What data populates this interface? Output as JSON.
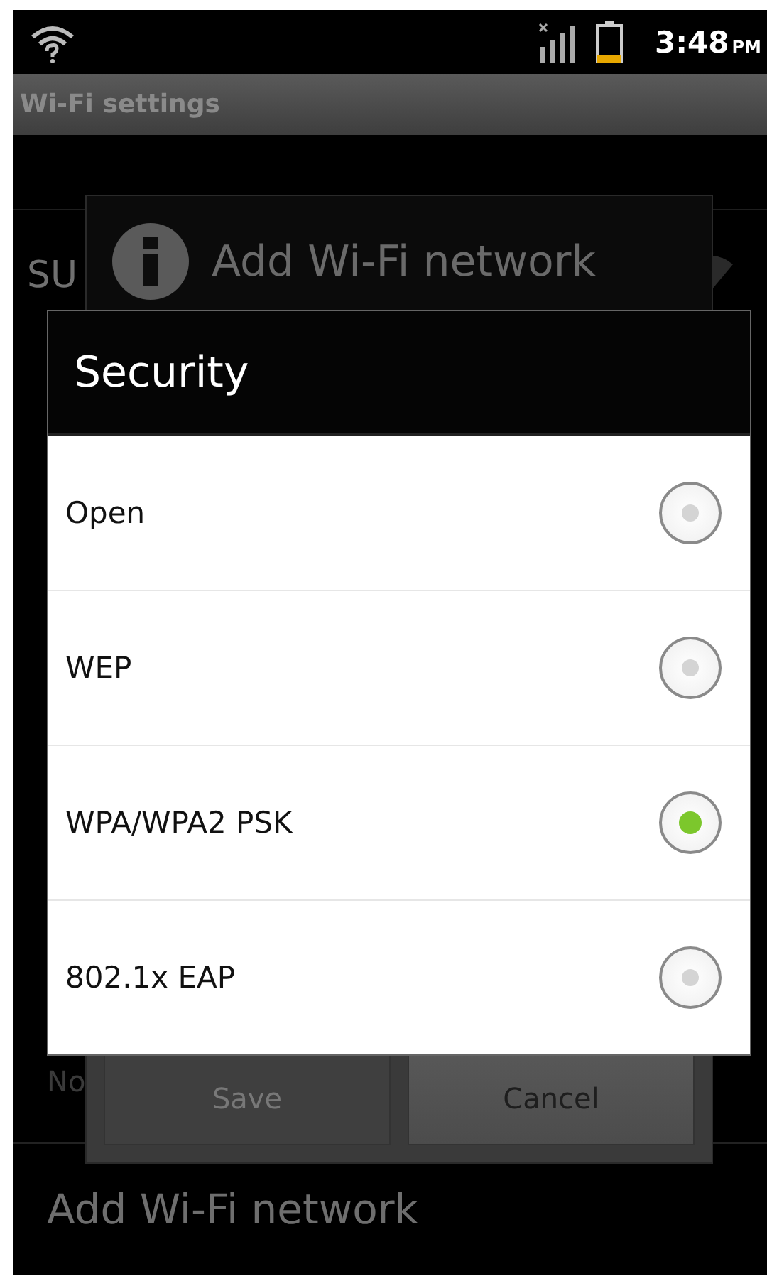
{
  "status_bar": {
    "time": "3:48",
    "time_suffix": "PM"
  },
  "title_bar": {
    "title": "Wi-Fi settings"
  },
  "background_list": [
    {
      "kind": "network",
      "label": "SU"
    },
    {
      "kind": "subtitle",
      "label": "No"
    },
    {
      "kind": "action",
      "label": "Add Wi-Fi network"
    }
  ],
  "add_network_dialog": {
    "title": "Add Wi-Fi network",
    "buttons": [
      {
        "label": "Save",
        "disabled": true
      },
      {
        "label": "Cancel",
        "disabled": false
      }
    ]
  },
  "security_dialog": {
    "title": "Security",
    "options": [
      {
        "label": "Open",
        "selected": false
      },
      {
        "label": "WEP",
        "selected": false
      },
      {
        "label": "WPA/WPA2 PSK",
        "selected": true
      },
      {
        "label": "802.1x EAP",
        "selected": false
      }
    ]
  }
}
